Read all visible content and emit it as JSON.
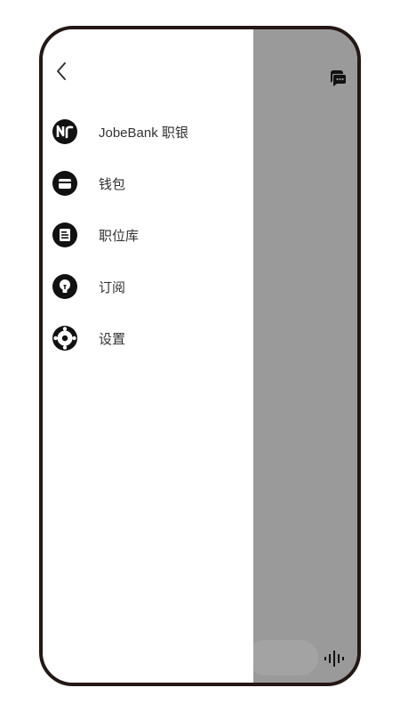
{
  "drawer": {
    "items": [
      {
        "label": "JobeBank 职银",
        "icon": "brand-logo-icon"
      },
      {
        "label": "钱包",
        "icon": "wallet-icon"
      },
      {
        "label": "职位库",
        "icon": "document-icon"
      },
      {
        "label": "订阅",
        "icon": "lightbulb-icon"
      },
      {
        "label": "设置",
        "icon": "gear-icon"
      }
    ]
  },
  "colors": {
    "frame": "#231815",
    "overlay": "#9a9a9a",
    "drawer_bg": "#ffffff",
    "icon": "#111111",
    "label": "#333333"
  },
  "icons": {
    "back": "chevron-left-icon",
    "chat": "chat-bubble-icon",
    "voice": "voice-wave-icon"
  }
}
